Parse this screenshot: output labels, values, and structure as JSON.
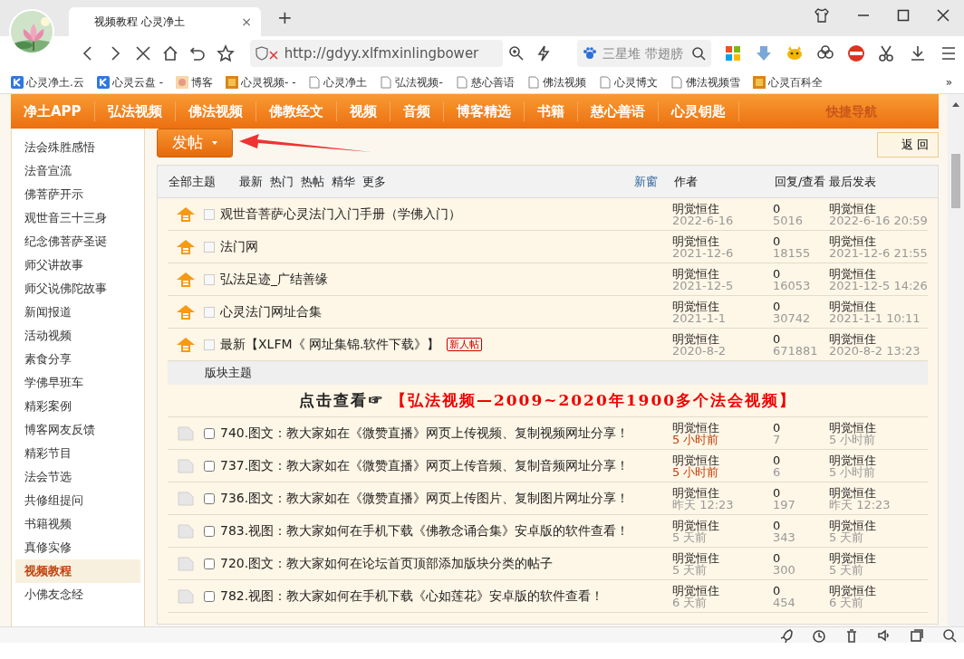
{
  "browser": {
    "tab": {
      "title": "视频教程 心灵净土",
      "close": "×"
    },
    "new_tab": "+",
    "address": "http://gdyy.xlfmxinlingbower",
    "search_placeholder": "三星堆 带翅膀",
    "bookmarks": [
      {
        "label": "心灵净土.云",
        "kind": "cloud"
      },
      {
        "label": "心灵云盘 -",
        "kind": "cloud"
      },
      {
        "label": "博客"
      },
      {
        "label": "心灵视频- -",
        "kind": "logo"
      },
      {
        "label": "心灵净土",
        "kind": "page"
      },
      {
        "label": "弘法视频-",
        "kind": "page"
      },
      {
        "label": "慈心善语",
        "kind": "page"
      },
      {
        "label": "佛法视频",
        "kind": "page"
      },
      {
        "label": "心灵博文",
        "kind": "page"
      },
      {
        "label": "佛法视频雪",
        "kind": "page"
      },
      {
        "label": "心灵百科全",
        "kind": "logo"
      }
    ],
    "more": "»"
  },
  "nav": {
    "items": [
      "净土APP",
      "弘法视频",
      "佛法视频",
      "佛教经文",
      "视频",
      "音频",
      "博客精选",
      "书籍",
      "慈心善语",
      "心灵钥匙"
    ],
    "quick": "快捷导航"
  },
  "post_button": "发帖",
  "back_button": "返 回",
  "sidebar": [
    {
      "label": "法会殊胜感悟",
      "selected": false
    },
    {
      "label": "法音宣流",
      "selected": false
    },
    {
      "label": "佛菩萨开示",
      "selected": false
    },
    {
      "label": "观世音三十三身",
      "selected": false
    },
    {
      "label": "纪念佛菩萨圣诞",
      "selected": false
    },
    {
      "label": "师父讲故事",
      "selected": false
    },
    {
      "label": "师父说佛陀故事",
      "selected": false
    },
    {
      "label": "新闻报道",
      "selected": false
    },
    {
      "label": "活动视频",
      "selected": false
    },
    {
      "label": "素食分享",
      "selected": false
    },
    {
      "label": "学佛早班车",
      "selected": false
    },
    {
      "label": "精彩案例",
      "selected": false
    },
    {
      "label": "博客网友反馈",
      "selected": false
    },
    {
      "label": "精彩节目",
      "selected": false
    },
    {
      "label": "法会节选",
      "selected": false
    },
    {
      "label": "共修组提问",
      "selected": false
    },
    {
      "label": "书籍视频",
      "selected": false
    },
    {
      "label": "真修实修",
      "selected": false
    },
    {
      "label": "视频教程",
      "selected": true
    },
    {
      "label": "小佛友念经",
      "selected": false
    }
  ],
  "table": {
    "header": {
      "all": "全部主题",
      "filters": [
        "最新",
        "热门",
        "热帖",
        "精华",
        "更多"
      ],
      "new_window": "新窗",
      "author": "作者",
      "replies": "回复/查看",
      "last": "最后发表"
    },
    "sticky": [
      {
        "checked": false,
        "title": "观世音菩萨心灵法门入门手册（学佛入门）",
        "author": "明觉恒住",
        "date": "2022-6-16",
        "replies": "0",
        "views": "5016",
        "last_user": "明觉恒住",
        "last_time": "2022-6-16 20:59"
      },
      {
        "checked": false,
        "title": "法门网",
        "author": "明觉恒住",
        "date": "2021-12-6",
        "replies": "0",
        "views": "18155",
        "last_user": "明觉恒住",
        "last_time": "2021-12-6 21:55"
      },
      {
        "checked": false,
        "title": "弘法足迹_广结善缘",
        "author": "明觉恒住",
        "date": "2021-12-5",
        "replies": "0",
        "views": "16053",
        "last_user": "明觉恒住",
        "last_time": "2021-12-5 14:26"
      },
      {
        "checked": false,
        "title": "心灵法门网址合集",
        "author": "明觉恒住",
        "date": "2021-1-1",
        "replies": "0",
        "views": "30742",
        "last_user": "明觉恒住",
        "last_time": "2021-1-1 10:11"
      },
      {
        "checked": false,
        "title": "最新【XLFM《 网址集锦.软件下载》】",
        "badge": "新人帖",
        "author": "明觉恒住",
        "date": "2020-8-2",
        "replies": "0",
        "views": "671881",
        "last_user": "明觉恒住",
        "last_time": "2020-8-2 13:23"
      }
    ],
    "section": "版块主题",
    "banner": {
      "lead": "点击查看☞",
      "link": "【弘法视频—2009~2020年1900多个法会视频】"
    },
    "threads": [
      {
        "checked": false,
        "title": "740.图文：教大家如在《微赞直播》网页上传视频、复制视频网址分享！",
        "author": "明觉恒住",
        "date": "5 小时前",
        "recent": true,
        "replies": "0",
        "views": "7",
        "last_user": "明觉恒住",
        "last_time": "5 小时前"
      },
      {
        "checked": false,
        "title": "737.图文：教大家如在《微赞直播》网页上传音频、复制音频网址分享！",
        "author": "明觉恒住",
        "date": "5 小时前",
        "recent": true,
        "replies": "0",
        "views": "6",
        "last_user": "明觉恒住",
        "last_time": "5 小时前"
      },
      {
        "checked": false,
        "title": "736.图文：教大家如在《微赞直播》网页上传图片、复制图片网址分享！",
        "author": "明觉恒住",
        "date": "昨天 12:23",
        "recent": false,
        "replies": "0",
        "views": "197",
        "last_user": "明觉恒住",
        "last_time": "昨天 12:23"
      },
      {
        "checked": false,
        "title": "783.视图：教大家如何在手机下载《佛教念诵合集》安卓版的软件查看！",
        "author": "明觉恒住",
        "date": "5 天前",
        "recent": false,
        "replies": "0",
        "views": "343",
        "last_user": "明觉恒住",
        "last_time": "5 天前"
      },
      {
        "checked": false,
        "title": "720.图文：教大家如何在论坛首页顶部添加版块分类的帖子",
        "author": "明觉恒住",
        "date": "5 天前",
        "recent": false,
        "replies": "0",
        "views": "300",
        "last_user": "明觉恒住",
        "last_time": "5 天前"
      },
      {
        "checked": false,
        "title": "782.视图：教大家如何在手机下载《心如莲花》安卓版的软件查看！",
        "author": "明觉恒住",
        "date": "6 天前",
        "recent": false,
        "replies": "0",
        "views": "454",
        "last_user": "明觉恒住",
        "last_time": "6 天前"
      }
    ]
  }
}
